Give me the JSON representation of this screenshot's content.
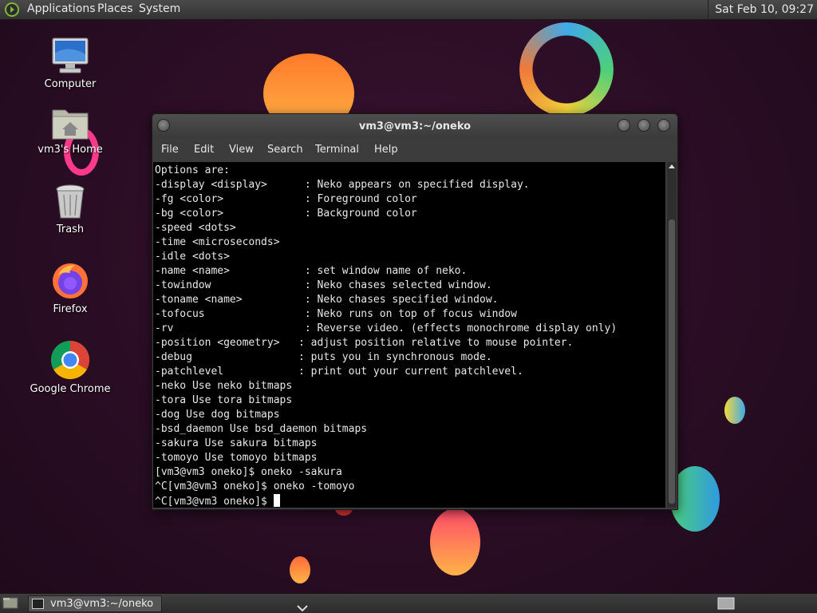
{
  "top_panel": {
    "menus": [
      "Applications",
      "Places",
      "System"
    ],
    "clock": "Sat Feb 10, 09:27"
  },
  "desktop_icons": [
    "Computer",
    "vm3's Home",
    "Trash",
    "Firefox",
    "Google Chrome"
  ],
  "window": {
    "title": "vm3@vm3:~/oneko",
    "menu": [
      "File",
      "Edit",
      "View",
      "Search",
      "Terminal",
      "Help"
    ],
    "lines": [
      "Options are:",
      "-display <display>      : Neko appears on specified display.",
      "-fg <color>             : Foreground color",
      "-bg <color>             : Background color",
      "-speed <dots>",
      "-time <microseconds>",
      "-idle <dots>",
      "-name <name>            : set window name of neko.",
      "-towindow               : Neko chases selected window.",
      "-toname <name>          : Neko chases specified window.",
      "-tofocus                : Neko runs on top of focus window",
      "-rv                     : Reverse video. (effects monochrome display only)",
      "-position <geometry>   : adjust position relative to mouse pointer.",
      "-debug                 : puts you in synchronous mode.",
      "-patchlevel            : print out your current patchlevel.",
      "-neko Use neko bitmaps",
      "-tora Use tora bitmaps",
      "-dog Use dog bitmaps",
      "-bsd_daemon Use bsd_daemon bitmaps",
      "-sakura Use sakura bitmaps",
      "-tomoyo Use tomoyo bitmaps",
      "[vm3@vm3 oneko]$ oneko -sakura",
      "^C[vm3@vm3 oneko]$ oneko -tomoyo"
    ],
    "prompt": "^C[vm3@vm3 oneko]$ "
  },
  "taskbar": {
    "window_button": "vm3@vm3:~/oneko"
  },
  "icons": {
    "panel_logo": "distro-logo-icon",
    "terminal": "terminal-icon"
  }
}
